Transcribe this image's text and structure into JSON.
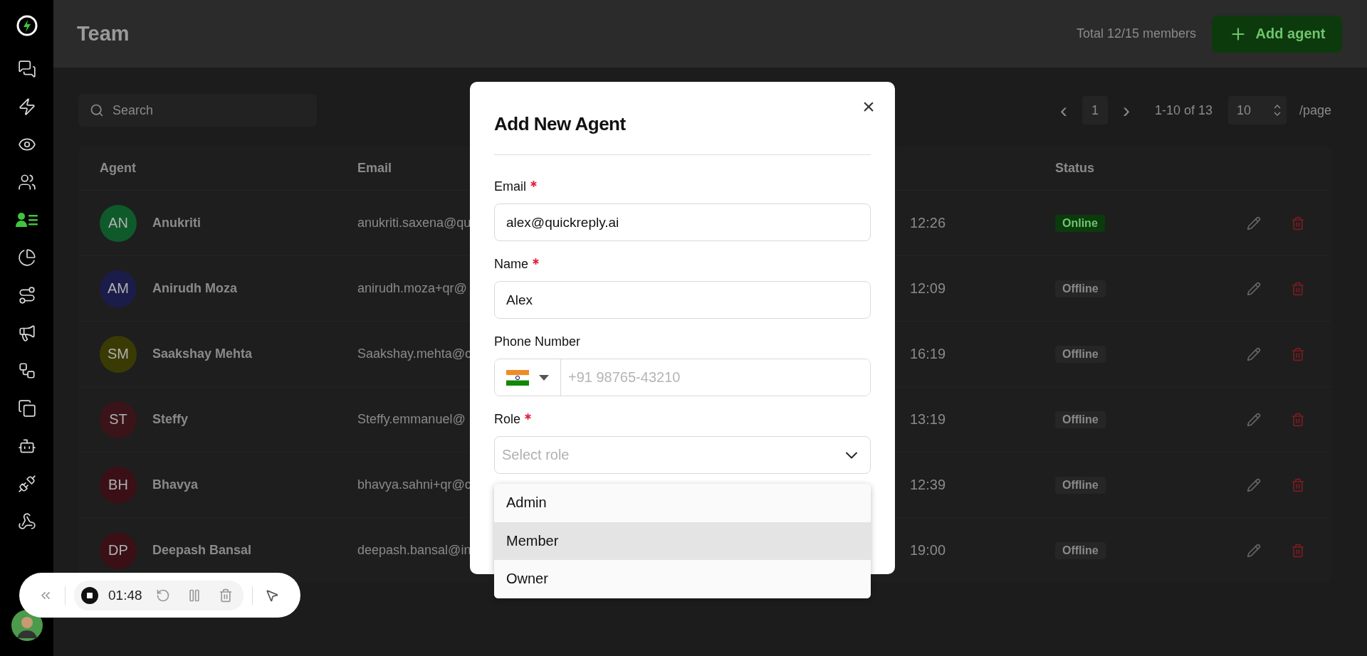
{
  "sidebar": {
    "items": [
      {
        "kind": "chats",
        "selected": false
      },
      {
        "kind": "bolt",
        "selected": false
      },
      {
        "kind": "eye",
        "selected": false
      },
      {
        "kind": "group",
        "selected": false
      },
      {
        "kind": "contacts",
        "selected": true
      },
      {
        "kind": "pie",
        "selected": false
      },
      {
        "kind": "route",
        "selected": false
      },
      {
        "kind": "megaphone",
        "selected": false
      },
      {
        "kind": "flow",
        "selected": false
      },
      {
        "kind": "windows",
        "selected": false
      },
      {
        "kind": "bot",
        "selected": false
      },
      {
        "kind": "plug",
        "selected": false
      },
      {
        "kind": "webhook",
        "selected": false
      }
    ]
  },
  "header": {
    "title": "Team",
    "total": "Total 12/15 members",
    "add_button": "Add agent"
  },
  "search": {
    "placeholder": "Search"
  },
  "pagination": {
    "prev": "‹",
    "page": "1",
    "next": "›",
    "range": "1-10 of 13",
    "per_page": "10",
    "per_page_suffix": "/page"
  },
  "table": {
    "columns": [
      "Agent",
      "Email",
      "Status"
    ],
    "rows": [
      {
        "initials": "AN",
        "color": "#0f5a2a",
        "name": "Anukriti",
        "email": "anukriti.saxena@qu",
        "time": "12:26",
        "status": "Online",
        "online": true
      },
      {
        "initials": "AM",
        "color": "#1c1c4a",
        "name": "Anirudh Moza",
        "email": "anirudh.moza+qr@",
        "time": "12:09",
        "status": "Offline",
        "online": false
      },
      {
        "initials": "SM",
        "color": "#3a3a05",
        "name": "Saakshay Mehta",
        "email": "Saakshay.mehta@c",
        "time": "16:19",
        "status": "Offline",
        "online": false
      },
      {
        "initials": "ST",
        "color": "#3a1418",
        "name": "Steffy",
        "email": "Steffy.emmanuel@",
        "time": "13:19",
        "status": "Offline",
        "online": false
      },
      {
        "initials": "BH",
        "color": "#3a1016",
        "name": "Bhavya",
        "email": "bhavya.sahni+qr@c",
        "time": "12:39",
        "status": "Offline",
        "online": false
      },
      {
        "initials": "DP",
        "color": "#3a1016",
        "name": "Deepash Bansal",
        "email": "deepash.bansal@in",
        "time": "19:00",
        "status": "Offline",
        "online": false
      }
    ]
  },
  "modal": {
    "title": "Add New Agent",
    "close": "×",
    "fields": [
      {
        "kind": "text",
        "label": "Email",
        "required": true,
        "value": "alex@quickreply.ai"
      },
      {
        "kind": "text",
        "label": "Name",
        "required": true,
        "value": "Alex"
      },
      {
        "kind": "phone",
        "label": "Phone Number",
        "required": false,
        "placeholder": "+91 98765-43210"
      },
      {
        "kind": "select",
        "label": "Role",
        "required": true,
        "placeholder": "Select role"
      }
    ],
    "role_options": [
      {
        "label": "Admin",
        "highlighted": false
      },
      {
        "label": "Member",
        "highlighted": true
      },
      {
        "label": "Owner",
        "highlighted": false
      }
    ]
  },
  "recorder": {
    "time": "01:48"
  }
}
